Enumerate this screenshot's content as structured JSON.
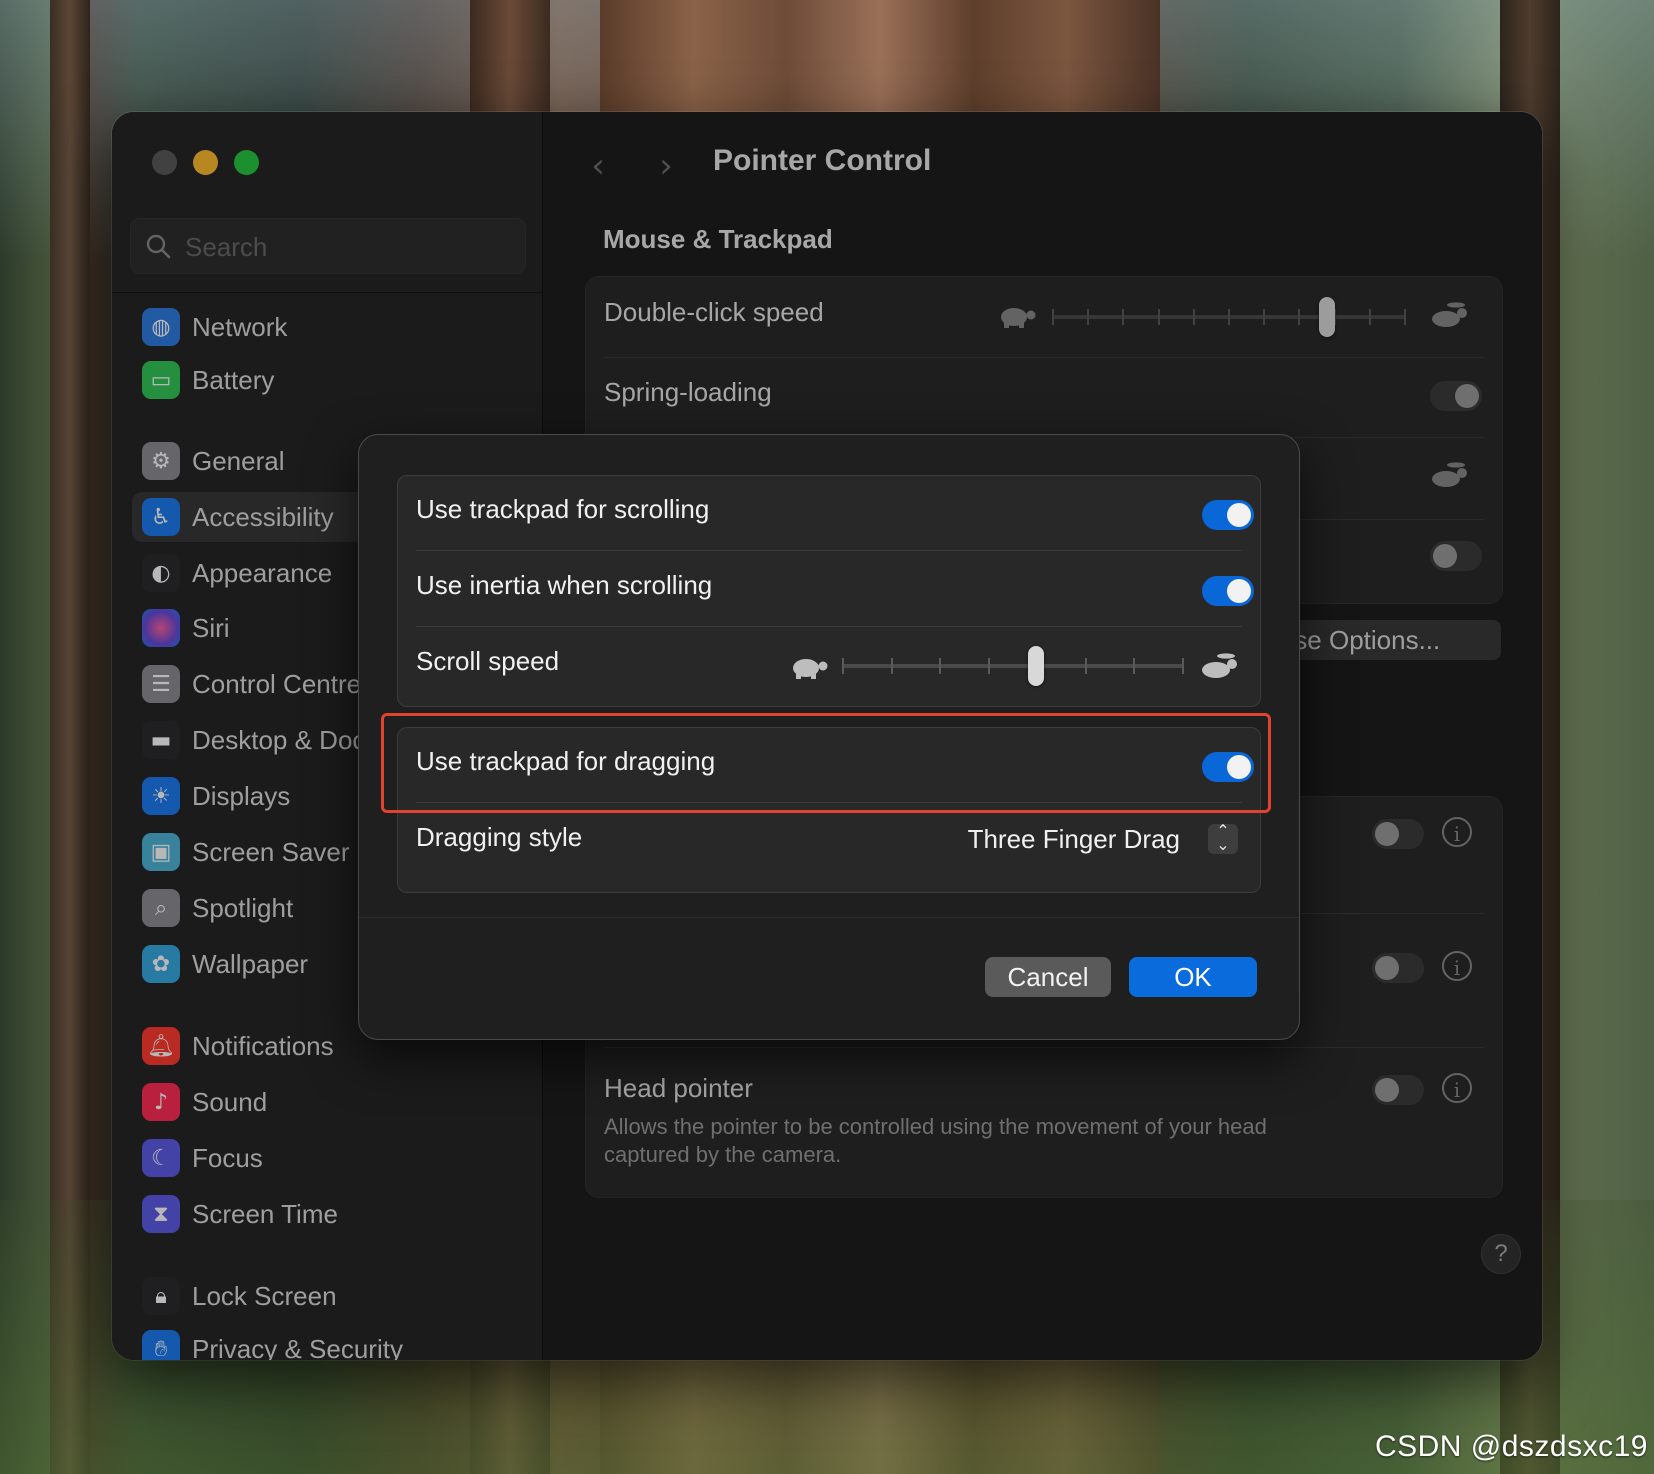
{
  "window": {
    "title": "Pointer Control",
    "section_title": "Mouse & Trackpad"
  },
  "sidebar": {
    "search_placeholder": "Search",
    "items": [
      {
        "label": "Network",
        "icon": "globe-icon",
        "color": "#2f7de1"
      },
      {
        "label": "Battery",
        "icon": "battery-icon",
        "color": "#34c759"
      },
      {
        "label": "General",
        "icon": "gear-icon",
        "color": "#8e8e93"
      },
      {
        "label": "Accessibility",
        "icon": "accessibility-icon",
        "color": "#1e7cf2"
      },
      {
        "label": "Appearance",
        "icon": "appearance-icon",
        "color": "#2c2c2e"
      },
      {
        "label": "Siri",
        "icon": "siri-icon",
        "color": "#b44fd6"
      },
      {
        "label": "Control Centre",
        "icon": "control-centre-icon",
        "color": "#8e8e93"
      },
      {
        "label": "Desktop & Dock",
        "icon": "dock-icon",
        "color": "#2c2c2e"
      },
      {
        "label": "Displays",
        "icon": "sun-icon",
        "color": "#1e7cf2"
      },
      {
        "label": "Screen Saver",
        "icon": "screen-saver-icon",
        "color": "#4fb4d8"
      },
      {
        "label": "Spotlight",
        "icon": "magnifier-icon",
        "color": "#8e8e93"
      },
      {
        "label": "Wallpaper",
        "icon": "flower-icon",
        "color": "#36a9e1"
      },
      {
        "label": "Notifications",
        "icon": "bell-icon",
        "color": "#ff3b30"
      },
      {
        "label": "Sound",
        "icon": "speaker-icon",
        "color": "#ff2d55"
      },
      {
        "label": "Focus",
        "icon": "moon-icon",
        "color": "#5e5ce6"
      },
      {
        "label": "Screen Time",
        "icon": "hourglass-icon",
        "color": "#5e5ce6"
      },
      {
        "label": "Lock Screen",
        "icon": "lock-icon",
        "color": "#2c2c2e"
      },
      {
        "label": "Privacy & Security",
        "icon": "hand-icon",
        "color": "#1e7cf2"
      }
    ]
  },
  "background_settings": {
    "double_click_label": "Double-click speed",
    "spring_loading_label": "Spring-loading",
    "mouse_options_button": "Mouse Options...",
    "head_pointer_label": "Head pointer",
    "head_pointer_desc": "Allows the pointer to be controlled using the movement of your head captured by the camera.",
    "help_label": "?",
    "double_click_speed_value": 0.79
  },
  "sheet": {
    "scrolling_label": "Use trackpad for scrolling",
    "scrolling_on": true,
    "inertia_label": "Use inertia when scrolling",
    "inertia_on": true,
    "scroll_speed_label": "Scroll speed",
    "scroll_speed_value": 0.57,
    "dragging_label": "Use trackpad for dragging",
    "dragging_on": true,
    "dragging_style_label": "Dragging style",
    "dragging_style_value": "Three Finger Drag",
    "cancel_label": "Cancel",
    "ok_label": "OK"
  },
  "watermark": "CSDN @dszdsxc19"
}
